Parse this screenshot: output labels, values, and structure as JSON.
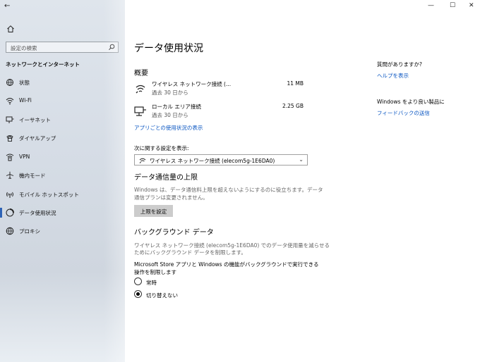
{
  "sidebar": {
    "search_placeholder": "設定の検索",
    "category": "ネットワークとインターネット",
    "items": [
      {
        "label": "状態",
        "icon": "globe-status-icon"
      },
      {
        "label": "Wi-Fi",
        "icon": "wifi-icon"
      },
      {
        "label": "イーサネット",
        "icon": "ethernet-icon"
      },
      {
        "label": "ダイヤルアップ",
        "icon": "dialup-icon"
      },
      {
        "label": "VPN",
        "icon": "vpn-icon"
      },
      {
        "label": "機内モード",
        "icon": "airplane-icon"
      },
      {
        "label": "モバイル ホットスポット",
        "icon": "hotspot-icon"
      },
      {
        "label": "データ使用状況",
        "icon": "data-usage-icon",
        "selected": true
      },
      {
        "label": "プロキシ",
        "icon": "globe-icon"
      }
    ]
  },
  "window": {
    "back": "←",
    "minimize": "—",
    "maximize": "☐",
    "close": "✕"
  },
  "main": {
    "title": "データ使用状況",
    "overview_heading": "概要",
    "connections": [
      {
        "name": "ワイヤレス ネットワーク接続 (...",
        "period": "過去 30 日から",
        "amount": "11 MB"
      },
      {
        "name": "ローカル エリア接続",
        "period": "過去 30 日から",
        "amount": "2.25 GB"
      }
    ],
    "per_app_link": "アプリごとの使用状況の表示",
    "show_settings_label": "次に関する設定を表示:",
    "selected_connection": "ワイヤレス ネットワーク接続 (elecom5g-1E6DA0)",
    "limit_heading": "データ通信量の上限",
    "limit_text_1": "Windows は、データ通信料上限を超えないようにするのに役立ちます。データ",
    "limit_text_2": "通信プランは変更されません。",
    "set_limit_button": "上限を設定",
    "bg_heading": "バックグラウンド データ",
    "bg_text_1": "ワイヤレス ネットワーク接続 (elecom5g-1E6DA0) でのデータ使用量を減らせる",
    "bg_text_2": "ためにバックグラウンド データを制限します。",
    "bg_question_1": "Microsoft Store アプリと Windows の機能がバックグラウンドで実行できる",
    "bg_question_2": "操作を制限します",
    "radio_always": "常時",
    "radio_never": "切り替えない"
  },
  "aside": {
    "question": "質問がありますか?",
    "help_link": "ヘルプを表示",
    "improve": "Windows をより良い製品に",
    "feedback_link": "フィードバックの送信"
  }
}
